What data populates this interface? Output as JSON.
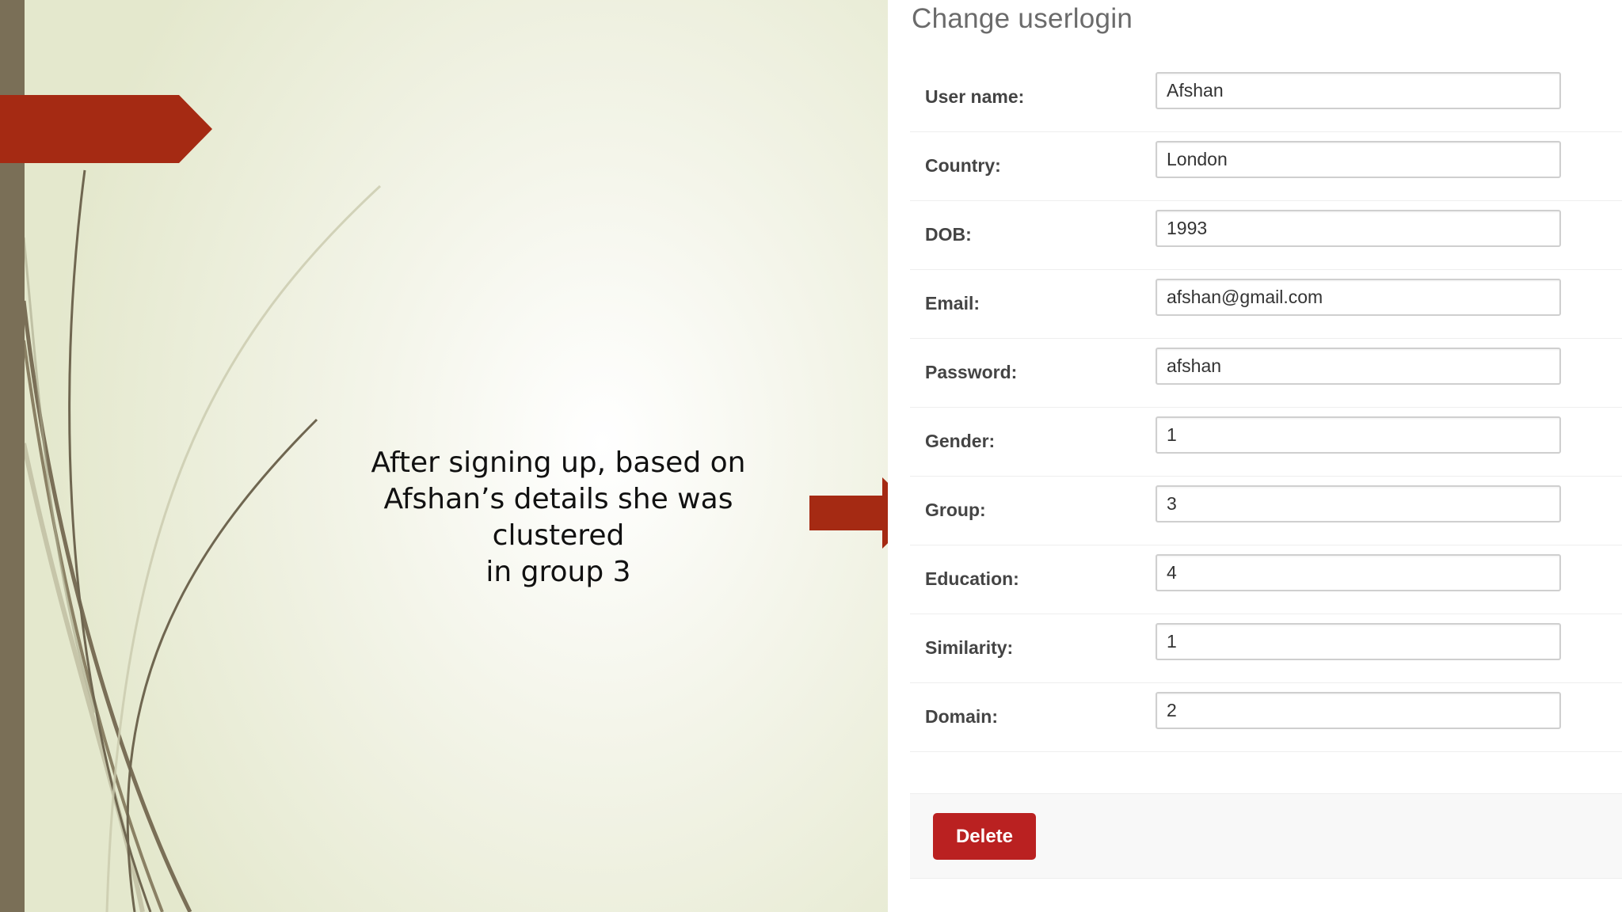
{
  "slide": {
    "caption_lines": [
      "After signing up, based on",
      "Afshan’s details she was clustered",
      "in group 3"
    ]
  },
  "form": {
    "title": "Change userlogin",
    "fields": [
      {
        "label": "User name:",
        "value": "Afshan"
      },
      {
        "label": "Country:",
        "value": "London"
      },
      {
        "label": "DOB:",
        "value": "1993"
      },
      {
        "label": "Email:",
        "value": "afshan@gmail.com"
      },
      {
        "label": "Password:",
        "value": "afshan"
      },
      {
        "label": "Gender:",
        "value": "1"
      },
      {
        "label": "Group:",
        "value": "3"
      },
      {
        "label": "Education:",
        "value": "4"
      },
      {
        "label": "Similarity:",
        "value": "1"
      },
      {
        "label": "Domain:",
        "value": "2"
      }
    ],
    "delete_label": "Delete"
  },
  "colors": {
    "accent_red": "#a52a13",
    "bar_brown": "#7a6f57",
    "delete_red": "#ba2121"
  }
}
